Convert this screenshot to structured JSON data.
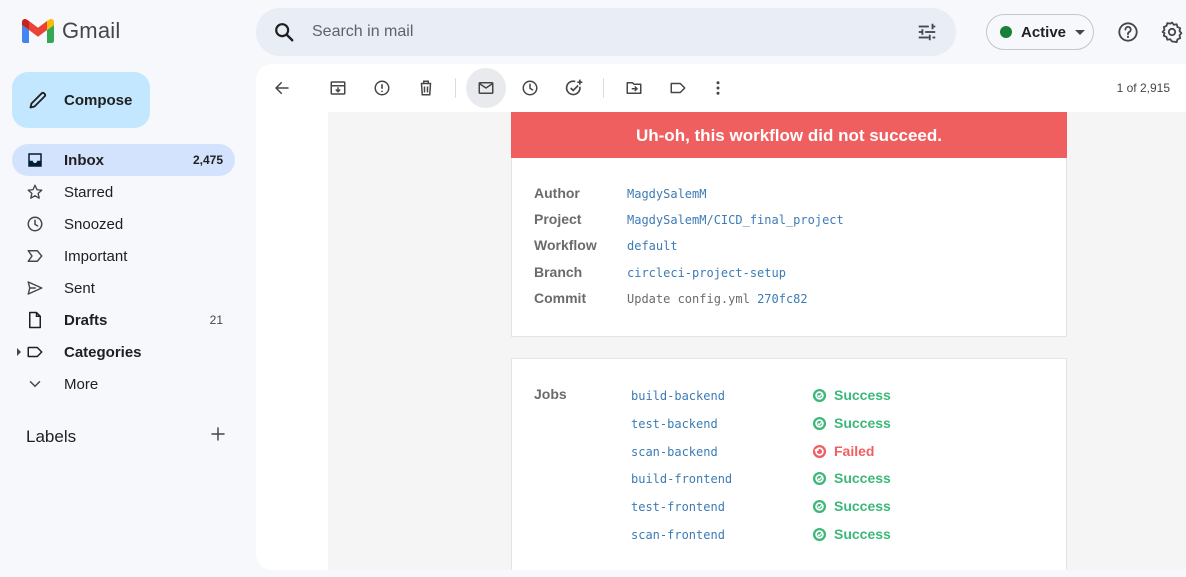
{
  "app": {
    "name": "Gmail"
  },
  "search": {
    "placeholder": "Search in mail"
  },
  "status": {
    "label": "Active",
    "color": "#188038"
  },
  "compose": {
    "label": "Compose"
  },
  "nav": [
    {
      "label": "Inbox",
      "count": "2,475",
      "icon": "inbox-icon"
    },
    {
      "label": "Starred",
      "count": "",
      "icon": "star-icon"
    },
    {
      "label": "Snoozed",
      "count": "",
      "icon": "clock-icon"
    },
    {
      "label": "Important",
      "count": "",
      "icon": "important-icon"
    },
    {
      "label": "Sent",
      "count": "",
      "icon": "send-icon"
    },
    {
      "label": "Drafts",
      "count": "21",
      "icon": "draft-icon"
    },
    {
      "label": "Categories",
      "count": "",
      "icon": "label-icon"
    },
    {
      "label": "More",
      "count": "",
      "icon": "chevron-down-icon"
    }
  ],
  "labels": {
    "title": "Labels"
  },
  "toolbar": {
    "pager": "1 of 2,915"
  },
  "email": {
    "banner": "Uh-oh, this workflow did not succeed.",
    "details": {
      "author_label": "Author",
      "author": "MagdySalemM",
      "project_label": "Project",
      "project": "MagdySalemM/CICD_final_project",
      "workflow_label": "Workflow",
      "workflow": "default",
      "branch_label": "Branch",
      "branch": "circleci-project-setup",
      "commit_label": "Commit",
      "commit_msg": "Update config.yml",
      "commit_hash": "270fc82"
    },
    "jobs_label": "Jobs",
    "jobs": [
      {
        "name": "build-backend",
        "status": "Success"
      },
      {
        "name": "test-backend",
        "status": "Success"
      },
      {
        "name": "scan-backend",
        "status": "Failed"
      },
      {
        "name": "build-frontend",
        "status": "Success"
      },
      {
        "name": "test-frontend",
        "status": "Success"
      },
      {
        "name": "scan-frontend",
        "status": "Success"
      }
    ],
    "colors": {
      "success": "#3cb878",
      "failed": "#ef5f5f",
      "banner": "#ef5f5f",
      "link": "#3d7bb5"
    }
  }
}
